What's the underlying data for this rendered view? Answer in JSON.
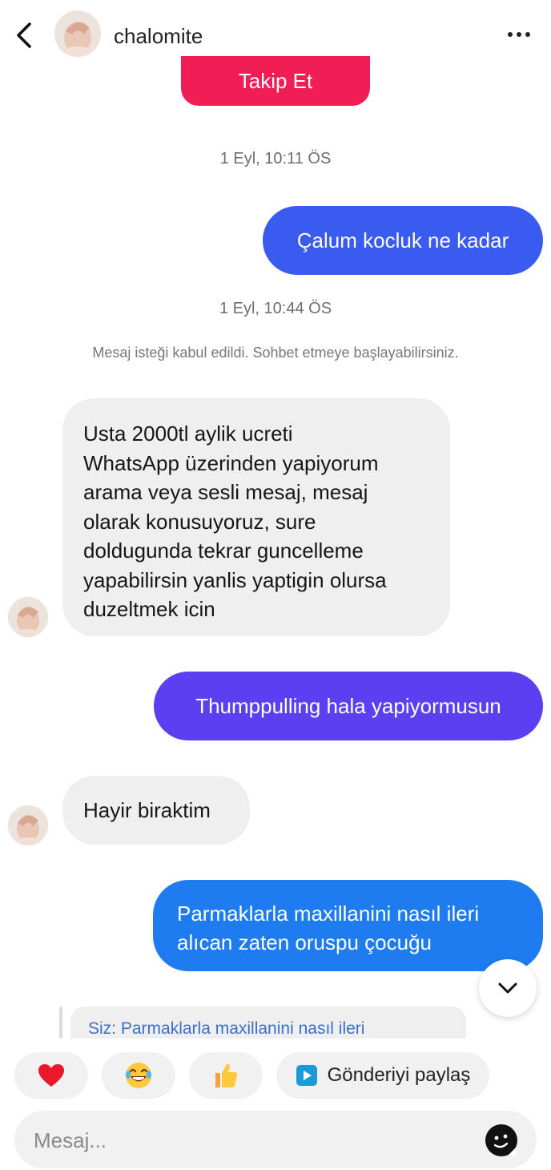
{
  "header": {
    "username": "chalomite"
  },
  "follow_button_label": "Takip Et",
  "messages": {
    "ts1": "1 Eyl, 10:11 ÖS",
    "out1": "Çalum kocluk ne kadar",
    "ts2": "1 Eyl, 10:44 ÖS",
    "system_note": "Mesaj isteği kabul edildi. Sohbet etmeye başlayabilirsiniz.",
    "in1_lines": [
      "Usta 2000tl aylik ucreti",
      "WhatsApp üzerinden yapiyorum",
      "arama veya sesli mesaj, mesaj",
      "olarak konusuyoruz, sure",
      "doldugunda tekrar guncelleme",
      "yapabilirsin yanlis yaptigin olursa",
      "duzeltmek icin"
    ],
    "out2": "Thumppulling hala yapiyormusun",
    "in2": "Hayir biraktim",
    "out3_lines": [
      "Parmaklarla maxillanini nasıl ileri",
      "alıcan zaten oruspu çocuğu"
    ]
  },
  "reply_preview": "Siz: Parmaklarla maxillanini nasıl ileri",
  "quick_actions": {
    "share_post_label": "Gönderiyi paylaş",
    "heart": "heart-emoji",
    "laugh": "laugh-emoji",
    "thumbs": "thumbs-up-emoji"
  },
  "composer": {
    "placeholder": "Mesaj..."
  },
  "colors": {
    "follow": "#f01e55",
    "bubble_blue_top": "#3a5bf0",
    "bubble_purple": "#5b3ff0",
    "bubble_blue_bottom": "#1e7cf0",
    "incoming_bg": "#efefef"
  }
}
